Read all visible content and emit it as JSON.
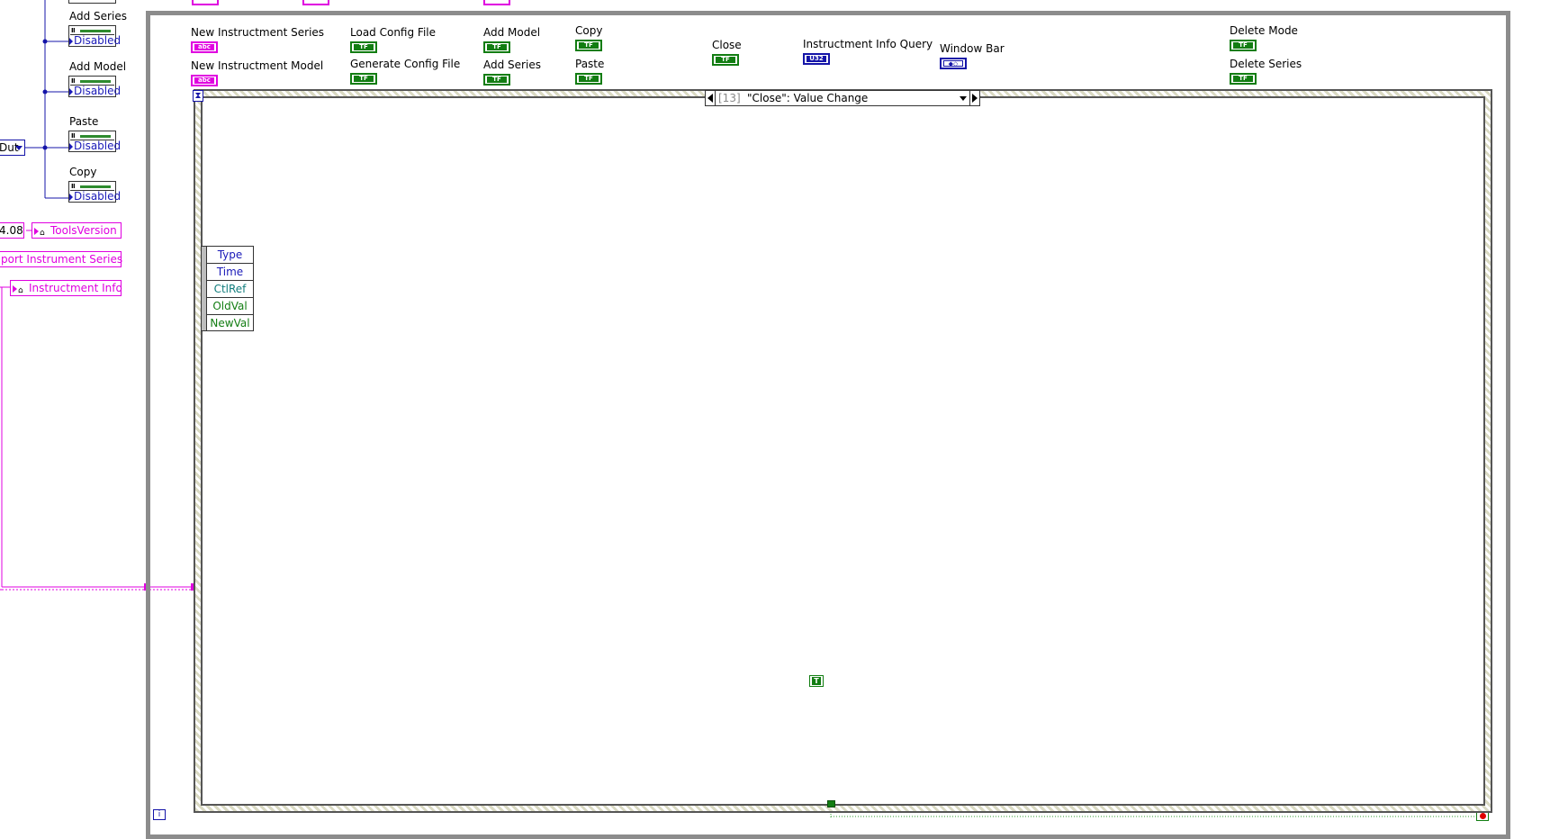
{
  "left_panel": {
    "nodes": [
      {
        "label": "Add Series",
        "property": "Disabled"
      },
      {
        "label": "Add Model",
        "property": "Disabled"
      },
      {
        "label": "Paste",
        "property": "Disabled"
      },
      {
        "label": "Copy",
        "property": "Disabled"
      }
    ],
    "enum_fragment": "Dut",
    "version_fragment": "4.08",
    "tools_version": "ToolsVersion",
    "import_series_fragment": "port Instrument Series",
    "instrument_info": "Instructment Info"
  },
  "controls": {
    "new_series": "New Instructment Series",
    "new_model": "New Instructment Model",
    "load_config": "Load Config File",
    "generate_config": "Generate Config File",
    "add_model": "Add Model",
    "add_series": "Add Series",
    "copy": "Copy",
    "paste": "Paste",
    "close": "Close",
    "info_query": "Instructment Info Query",
    "window_bar": "Window Bar",
    "delete_mode": "Delete Mode",
    "delete_series": "Delete Series"
  },
  "terminal_glyphs": {
    "bool": "TF",
    "string": "abc",
    "u32": "U32",
    "ref": "◆◇",
    "true_const": "T"
  },
  "event_structure": {
    "case_index": "[13]",
    "case_name": "\"Close\": Value Change",
    "event_data": [
      "Type",
      "Time",
      "CtlRef",
      "OldVal",
      "NewVal"
    ],
    "event_data_colors": [
      "#1a1ab8",
      "#1a1ab8",
      "#127d7d",
      "#127d12",
      "#127d12"
    ]
  },
  "loop": {
    "iteration_label": "i"
  },
  "colors": {
    "bool_wire": "#127d12",
    "string_wire": "#e000e0",
    "enum_wire": "#1414a8"
  }
}
